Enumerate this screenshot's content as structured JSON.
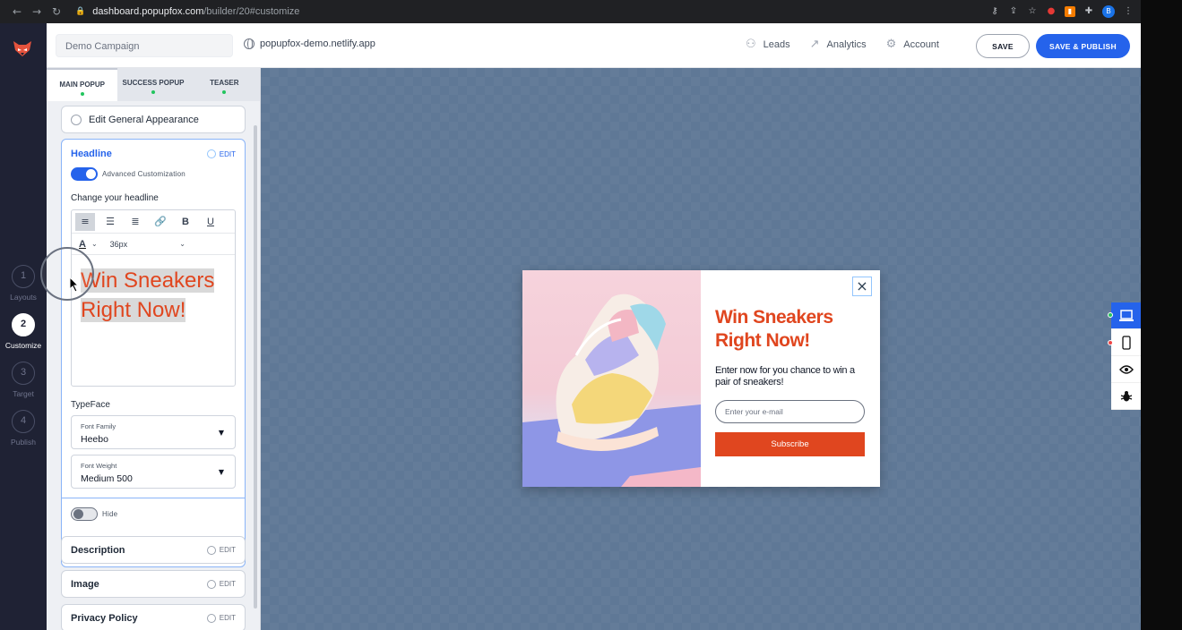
{
  "browser": {
    "url_host": "dashboard.popupfox.com",
    "url_path": "/builder/20#customize",
    "profile_initial": "B"
  },
  "rail": {
    "steps": [
      {
        "number": "1",
        "label": "Layouts"
      },
      {
        "number": "2",
        "label": "Customize"
      },
      {
        "number": "3",
        "label": "Target"
      },
      {
        "number": "4",
        "label": "Publish"
      }
    ]
  },
  "header": {
    "campaign_name": "Demo Campaign",
    "site": "popupfox-demo.netlify.app",
    "nav": [
      {
        "label": "Leads",
        "icon": "leads-icon"
      },
      {
        "label": "Analytics",
        "icon": "analytics-icon"
      },
      {
        "label": "Account",
        "icon": "account-icon"
      }
    ],
    "save_label": "SAVE",
    "publish_label": "SAVE & PUBLISH"
  },
  "panel": {
    "tabs": [
      {
        "label": "MAIN POPUP"
      },
      {
        "label": "SUCCESS POPUP"
      },
      {
        "label": "TEASER"
      }
    ],
    "general_appearance": "Edit General Appearance",
    "headline": {
      "title": "Headline",
      "edit": "EDIT",
      "advanced": "Advanced Customization",
      "change_label": "Change your headline",
      "font_size": "36px",
      "text_line1": "Win Sneakers",
      "text_line2": "Right Now!",
      "typeface_label": "TypeFace",
      "font_family_caption": "Font Family",
      "font_family_value": "Heebo",
      "font_weight_caption": "Font Weight",
      "font_weight_value": "Medium 500",
      "hide_label": "Hide"
    },
    "sections": [
      {
        "title": "Description",
        "edit": "EDIT"
      },
      {
        "title": "Image",
        "edit": "EDIT"
      },
      {
        "title": "Privacy Policy",
        "edit": "EDIT"
      }
    ]
  },
  "popup": {
    "title_line1": "Win Sneakers",
    "title_line2": "Right Now!",
    "description": "Enter now for you chance to win a pair of sneakers!",
    "email_placeholder": "Enter your e-mail",
    "button_label": "Subscribe",
    "accent_color": "#e0461f"
  },
  "colors": {
    "primary": "#2563eb",
    "rail_bg": "#1f2234",
    "canvas_bg": "#5f7896"
  }
}
